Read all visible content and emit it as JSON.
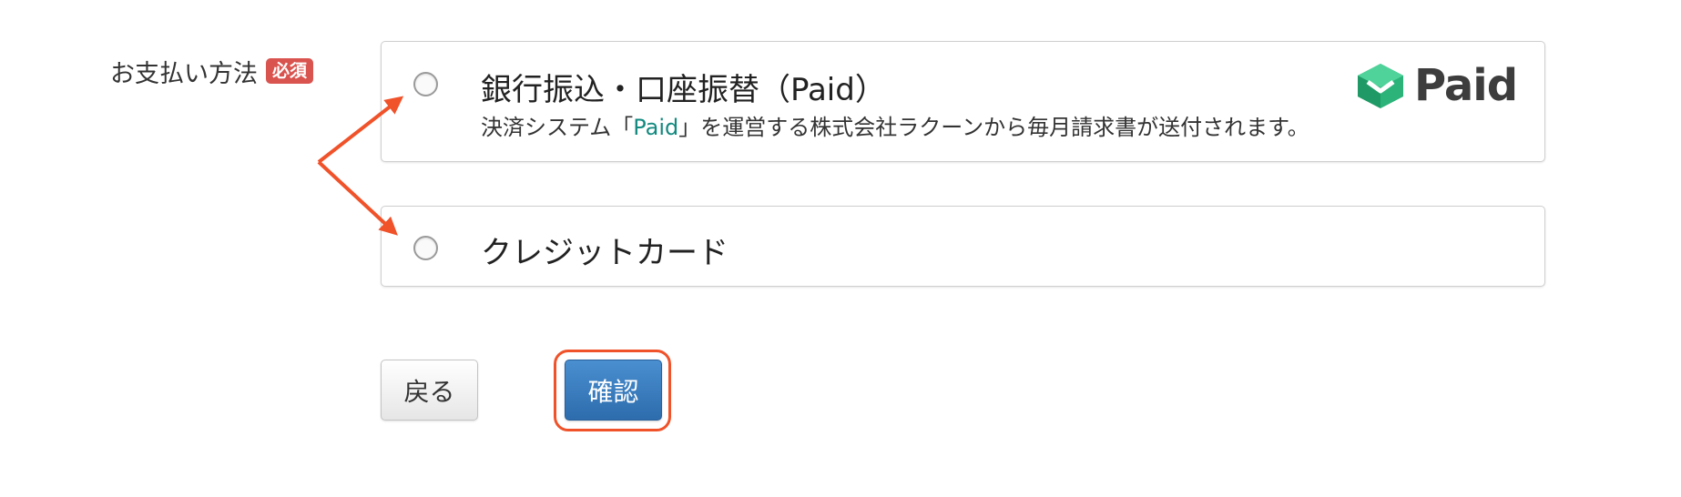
{
  "form": {
    "payment_label": "お支払い方法",
    "required_badge": "必須"
  },
  "options": {
    "paid": {
      "title": "銀行振込・口座振替（Paid）",
      "desc_prefix": "決済システム「",
      "desc_link": "Paid",
      "desc_suffix": "」を運営する株式会社ラクーンから毎月請求書が送付されます。",
      "logo_text": "Paid",
      "selected": false
    },
    "credit": {
      "title": "クレジットカード",
      "selected": false
    }
  },
  "buttons": {
    "back_label": "戻る",
    "confirm_label": "確認"
  },
  "colors": {
    "required_badge": "#d9534f",
    "paid_link": "#138a80",
    "primary_button": "#337ab7",
    "annotation": "#f0522a",
    "paid_logo_green": "#2bb37a"
  }
}
